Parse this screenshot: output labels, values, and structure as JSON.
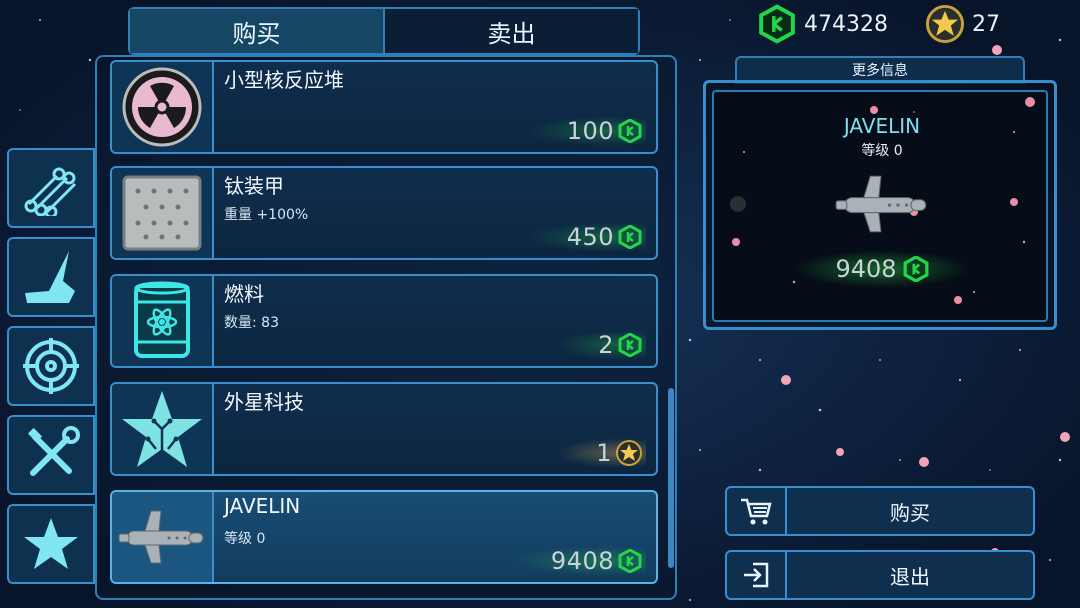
{
  "tabs": [
    {
      "label": "购买",
      "active": true
    },
    {
      "label": "卖出",
      "active": false
    }
  ],
  "categories": [
    {
      "icon": "pipes-icon"
    },
    {
      "icon": "crane-arm-icon"
    },
    {
      "icon": "crosshair-icon"
    },
    {
      "icon": "tools-icon"
    },
    {
      "icon": "star-icon"
    }
  ],
  "items": [
    {
      "title": "小型核反应堆",
      "subtitle": "",
      "price": "100",
      "currency": "credits",
      "icon": "radiation-icon"
    },
    {
      "title": "钛装甲",
      "subtitle": "重量 +100%",
      "price": "450",
      "currency": "credits",
      "icon": "armor-plate-icon"
    },
    {
      "title": "燃料",
      "subtitle": "数量: 83",
      "price": "2",
      "currency": "credits",
      "icon": "fuel-barrel-icon"
    },
    {
      "title": "外星科技",
      "subtitle": "",
      "price": "1",
      "currency": "star",
      "icon": "alien-tech-star-icon"
    },
    {
      "title": "JAVELIN",
      "subtitle": "等级 0",
      "price": "9408",
      "currency": "credits",
      "icon": "spaceship-icon",
      "selected": true
    }
  ],
  "currency": {
    "credits": "474328",
    "stars": "27"
  },
  "info": {
    "tab_label": "更多信息",
    "name": "JAVELIN",
    "level": "等级 0",
    "price": "9408"
  },
  "actions": {
    "buy": "购买",
    "exit": "退出"
  },
  "colors": {
    "accent": "#3a8ecb",
    "credit_green": "#22d64a",
    "name_cyan": "#7ee0ee",
    "star_gold": "#f3c94b"
  }
}
